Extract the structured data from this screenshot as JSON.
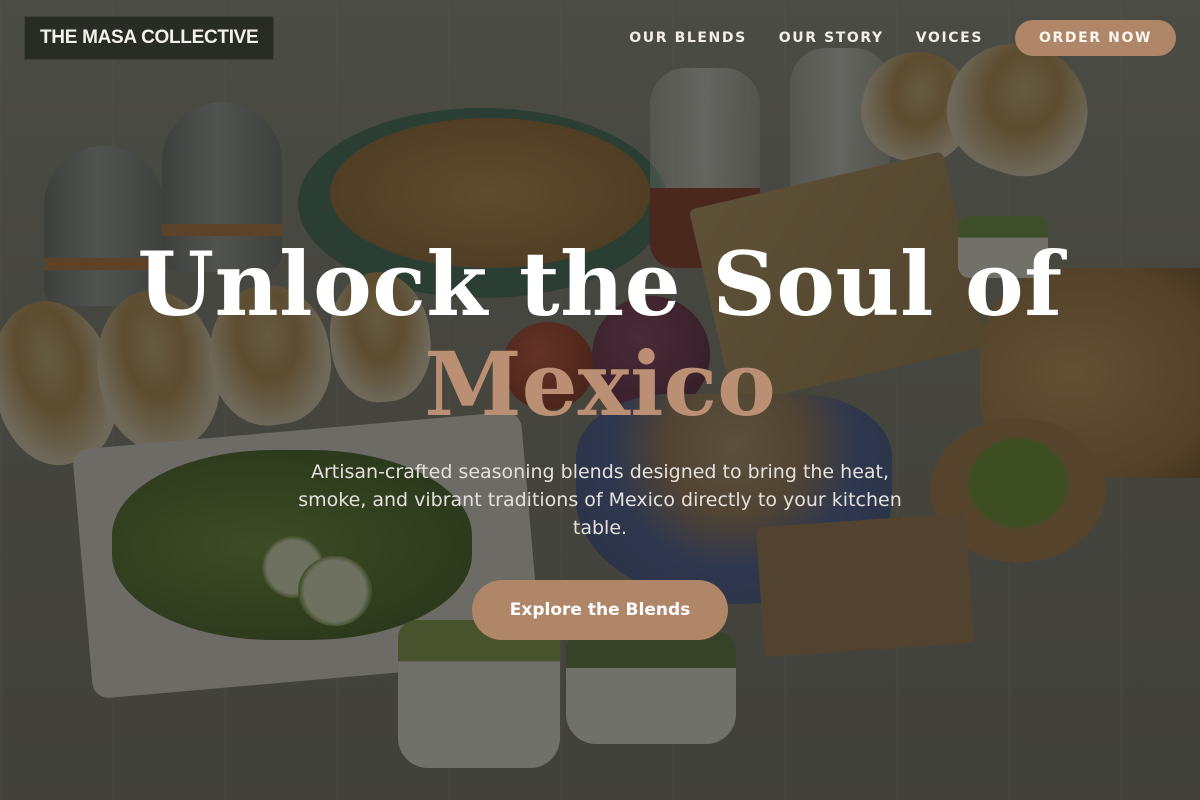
{
  "header": {
    "brand": "THE MASA COLLECTIVE",
    "nav": [
      "OUR BLENDS",
      "OUR STORY",
      "VOICES"
    ],
    "order_button": "ORDER NOW"
  },
  "hero": {
    "headline_line1": "Unlock the Soul of",
    "headline_line2": "Mexico",
    "subtitle": "Artisan-crafted seasoning blends designed to bring the heat, smoke, and vibrant traditions of Mexico directly to your kitchen table.",
    "cta": "Explore the Blends"
  },
  "colors": {
    "accent": "#b08669",
    "headline_accent": "#bb8f74",
    "brand_box": "#292b25"
  }
}
